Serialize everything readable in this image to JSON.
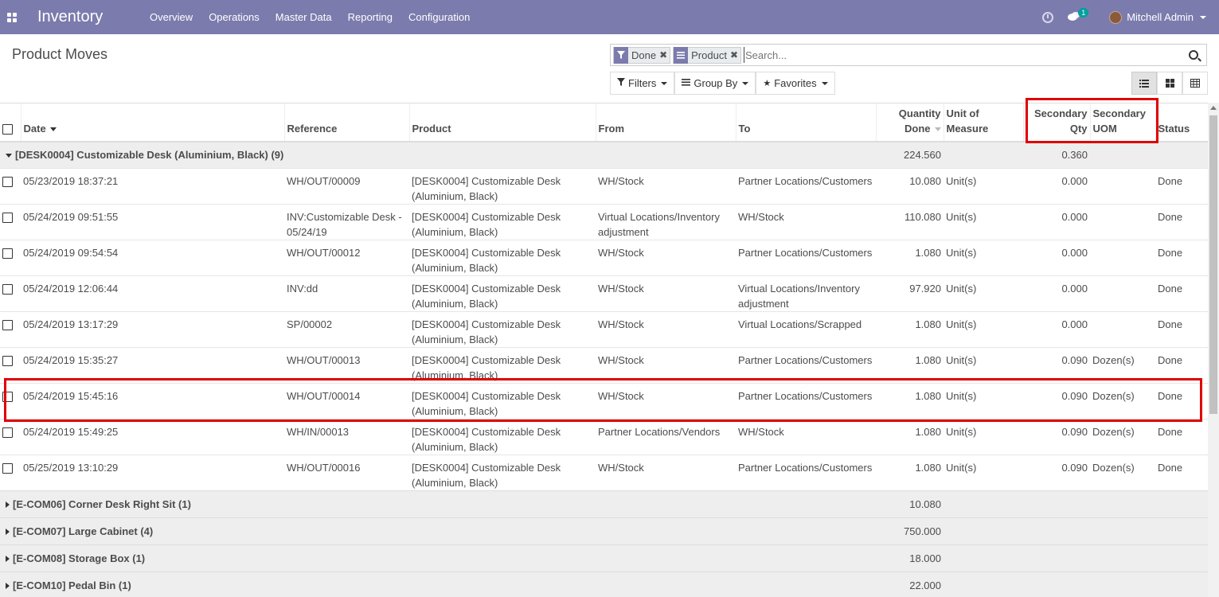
{
  "navbar": {
    "app_name": "Inventory",
    "menu": [
      "Overview",
      "Operations",
      "Master Data",
      "Reporting",
      "Configuration"
    ],
    "message_count": "1",
    "user_name": "Mitchell Admin",
    "bg_color": "#7c7bad"
  },
  "control_panel": {
    "title": "Product Moves",
    "facets": [
      {
        "icon": "filter-icon",
        "label": "Done"
      },
      {
        "icon": "group-by-icon",
        "label": "Product"
      }
    ],
    "search_placeholder": "Search...",
    "buttons": {
      "filters": "Filters",
      "group_by": "Group By",
      "favorites": "Favorites"
    },
    "views": [
      "list-view-icon",
      "kanban-view-icon",
      "pivot-view-icon"
    ],
    "active_view": "list"
  },
  "table": {
    "columns": [
      "Date",
      "Reference",
      "Product",
      "From",
      "To",
      "Quantity Done",
      "Unit of Measure",
      "Secondary Qty",
      "Secondary UOM",
      "Status"
    ],
    "col_header_lines": {
      "qty_done": [
        "Quantity",
        "Done"
      ],
      "uom": [
        "Unit of",
        "Measure"
      ],
      "sec_qty": [
        "Secondary",
        "Qty"
      ],
      "sec_uom": [
        "Secondary",
        "UOM"
      ]
    },
    "groups": [
      {
        "label": "[DESK0004] Customizable Desk (Aluminium, Black) (9)",
        "qty": "224.560",
        "sec_qty": "0.360",
        "expanded": true,
        "rows": [
          {
            "date": "05/23/2019 18:37:21",
            "reference": "WH/OUT/00009",
            "product": "[DESK0004] Customizable Desk (Aluminium, Black)",
            "from": "WH/Stock",
            "to": "Partner Locations/Customers",
            "qty": "10.080",
            "uom": "Unit(s)",
            "sec_qty": "0.000",
            "sec_uom": "",
            "status": "Done"
          },
          {
            "date": "05/24/2019 09:51:55",
            "reference": "INV:Customizable Desk - 05/24/19",
            "product": "[DESK0004] Customizable Desk (Aluminium, Black)",
            "from": "Virtual Locations/Inventory adjustment",
            "to": "WH/Stock",
            "qty": "110.080",
            "uom": "Unit(s)",
            "sec_qty": "0.000",
            "sec_uom": "",
            "status": "Done"
          },
          {
            "date": "05/24/2019 09:54:54",
            "reference": "WH/OUT/00012",
            "product": "[DESK0004] Customizable Desk (Aluminium, Black)",
            "from": "WH/Stock",
            "to": "Partner Locations/Customers",
            "qty": "1.080",
            "uom": "Unit(s)",
            "sec_qty": "0.000",
            "sec_uom": "",
            "status": "Done"
          },
          {
            "date": "05/24/2019 12:06:44",
            "reference": "INV:dd",
            "product": "[DESK0004] Customizable Desk (Aluminium, Black)",
            "from": "WH/Stock",
            "to": "Virtual Locations/Inventory adjustment",
            "qty": "97.920",
            "uom": "Unit(s)",
            "sec_qty": "0.000",
            "sec_uom": "",
            "status": "Done"
          },
          {
            "date": "05/24/2019 13:17:29",
            "reference": "SP/00002",
            "product": "[DESK0004] Customizable Desk (Aluminium, Black)",
            "from": "WH/Stock",
            "to": "Virtual Locations/Scrapped",
            "qty": "1.080",
            "uom": "Unit(s)",
            "sec_qty": "0.000",
            "sec_uom": "",
            "status": "Done"
          },
          {
            "date": "05/24/2019 15:35:27",
            "reference": "WH/OUT/00013",
            "product": "[DESK0004] Customizable Desk (Aluminium, Black)",
            "from": "WH/Stock",
            "to": "Partner Locations/Customers",
            "qty": "1.080",
            "uom": "Unit(s)",
            "sec_qty": "0.090",
            "sec_uom": "Dozen(s)",
            "status": "Done"
          },
          {
            "date": "05/24/2019 15:45:16",
            "reference": "WH/OUT/00014",
            "product": "[DESK0004] Customizable Desk (Aluminium, Black)",
            "from": "WH/Stock",
            "to": "Partner Locations/Customers",
            "qty": "1.080",
            "uom": "Unit(s)",
            "sec_qty": "0.090",
            "sec_uom": "Dozen(s)",
            "status": "Done"
          },
          {
            "date": "05/24/2019 15:49:25",
            "reference": "WH/IN/00013",
            "product": "[DESK0004] Customizable Desk (Aluminium, Black)",
            "from": "Partner Locations/Vendors",
            "to": "WH/Stock",
            "qty": "1.080",
            "uom": "Unit(s)",
            "sec_qty": "0.090",
            "sec_uom": "Dozen(s)",
            "status": "Done"
          },
          {
            "date": "05/25/2019 13:10:29",
            "reference": "WH/OUT/00016",
            "product": "[DESK0004] Customizable Desk (Aluminium, Black)",
            "from": "WH/Stock",
            "to": "Partner Locations/Customers",
            "qty": "1.080",
            "uom": "Unit(s)",
            "sec_qty": "0.090",
            "sec_uom": "Dozen(s)",
            "status": "Done"
          }
        ]
      },
      {
        "label": "[E-COM06] Corner Desk Right Sit (1)",
        "qty": "10.080",
        "sec_qty": "",
        "expanded": false,
        "rows": []
      },
      {
        "label": "[E-COM07] Large Cabinet (4)",
        "qty": "750.000",
        "sec_qty": "",
        "expanded": false,
        "rows": []
      },
      {
        "label": "[E-COM08] Storage Box (1)",
        "qty": "18.000",
        "sec_qty": "",
        "expanded": false,
        "rows": []
      },
      {
        "label": "[E-COM10] Pedal Bin (1)",
        "qty": "22.000",
        "sec_qty": "",
        "expanded": false,
        "rows": []
      }
    ]
  },
  "highlight_color": "#e00000"
}
